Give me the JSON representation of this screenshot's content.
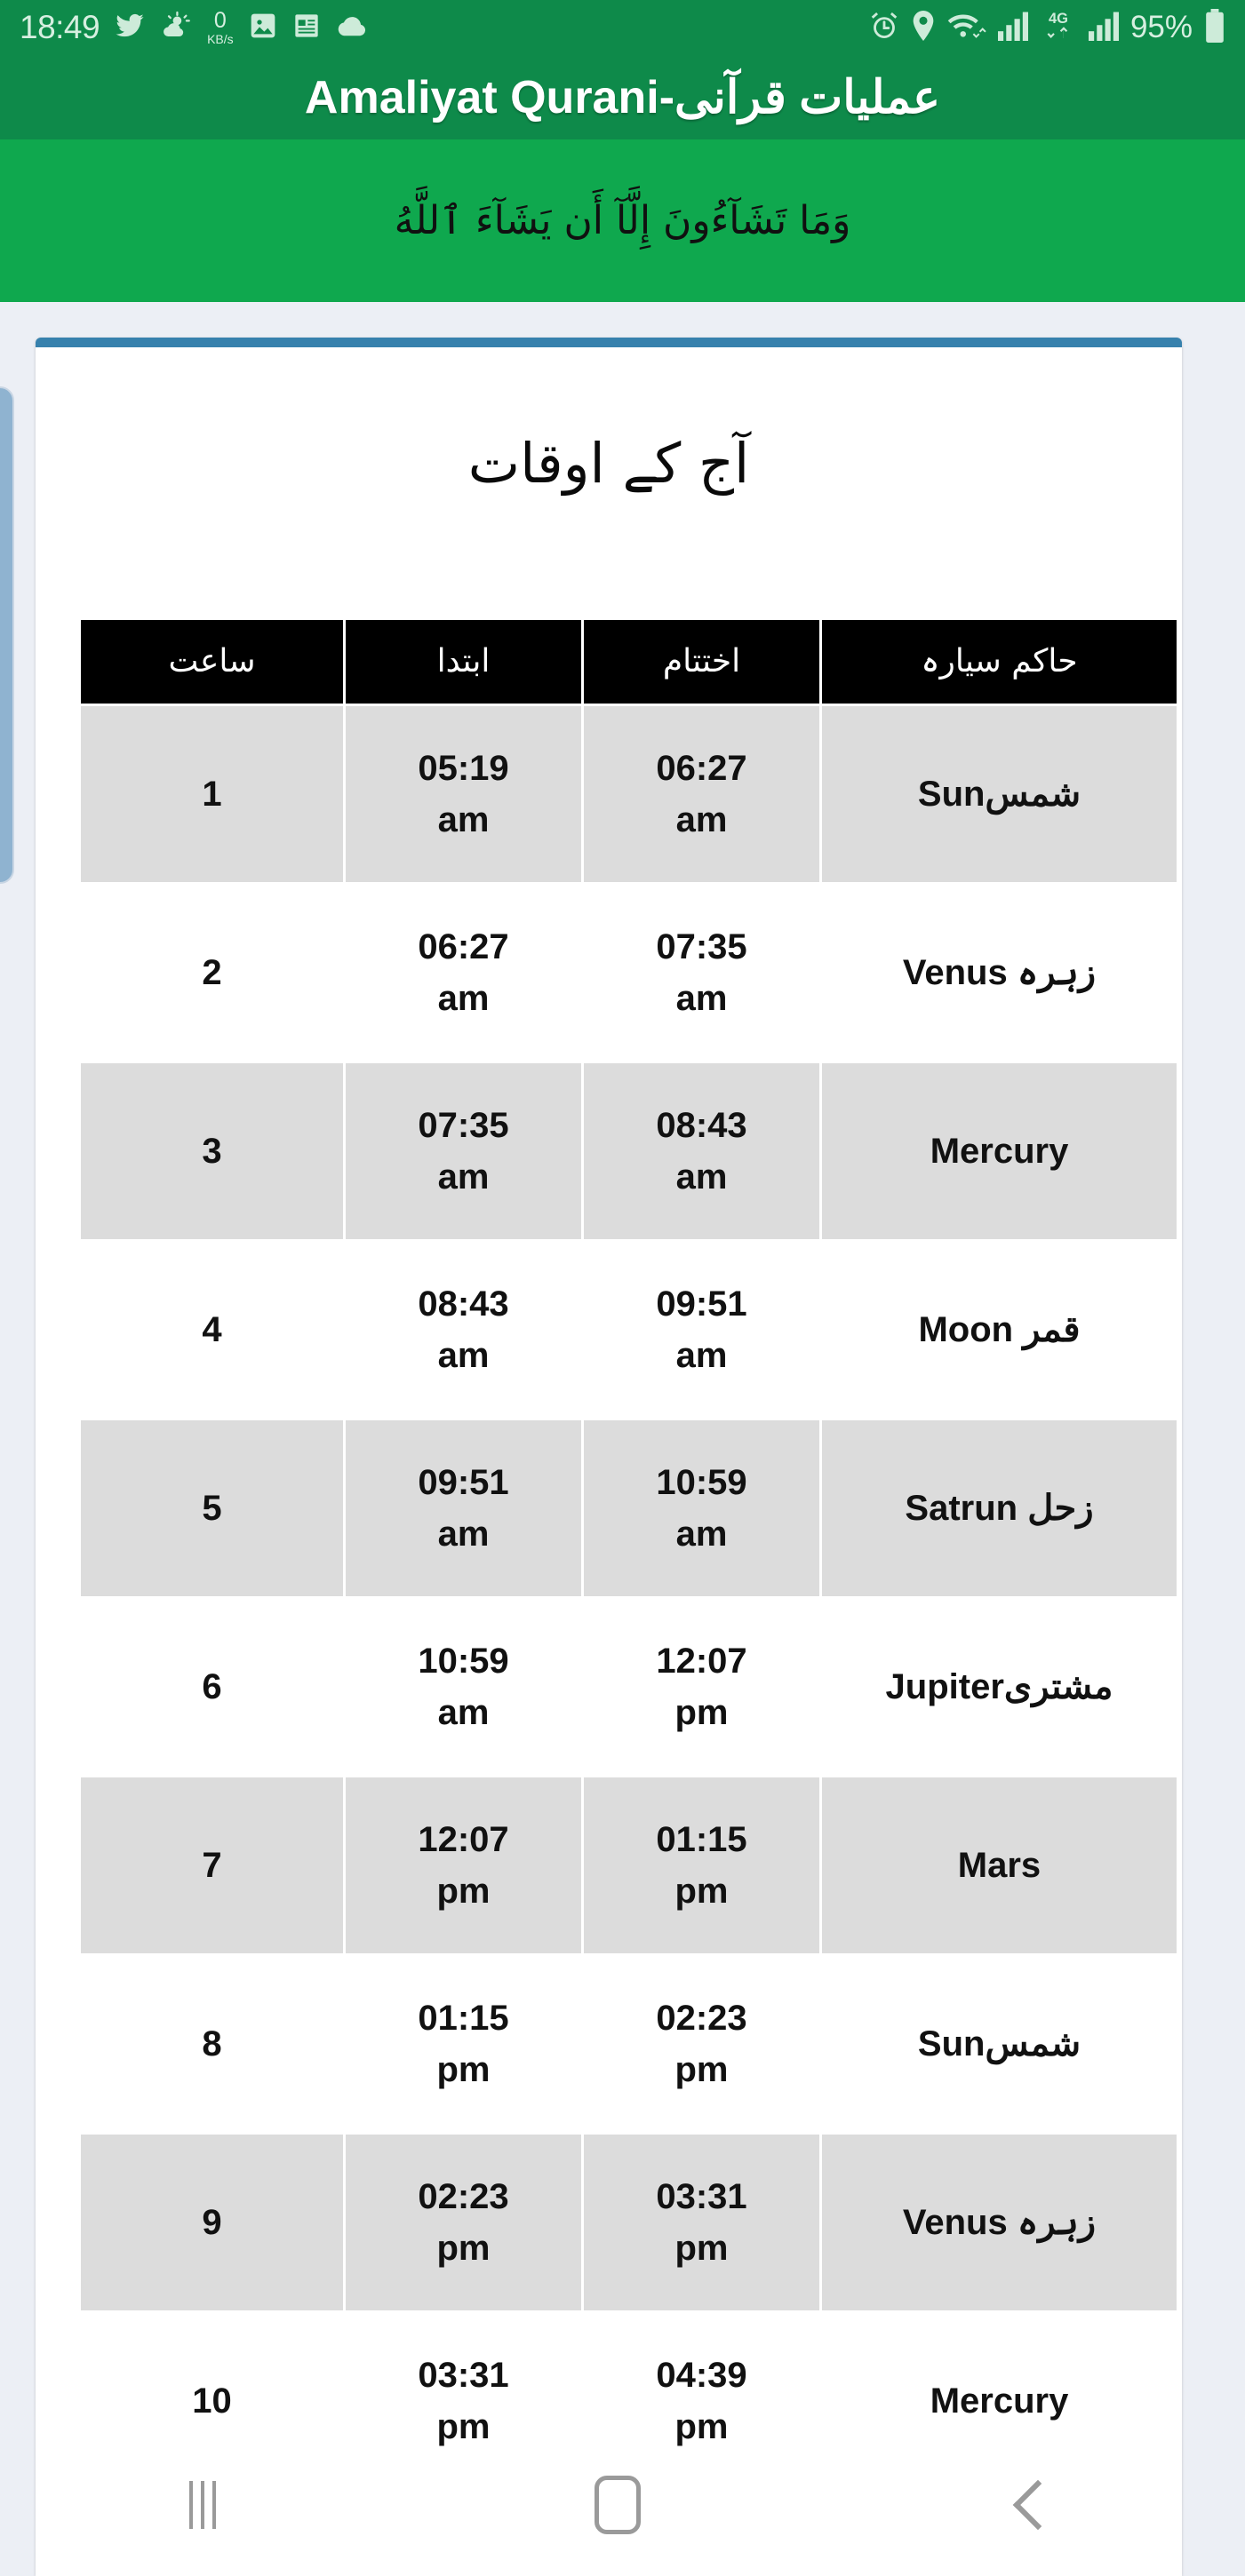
{
  "statusbar": {
    "time": "18:49",
    "data_rate_value": "0",
    "data_rate_unit": "KB/s",
    "battery_percent": "95%",
    "network_type": "4G",
    "icons": [
      "twitter-icon",
      "weather-icon",
      "data-speed-icon",
      "gallery-icon",
      "news-icon",
      "cloud-icon",
      "alarm-icon",
      "location-icon",
      "wifi-icon",
      "signal-icon",
      "mobile-data-icon",
      "signal-icon-2",
      "battery-icon"
    ]
  },
  "appbar": {
    "title": "عملیات قرآنی-Amaliyat Qurani"
  },
  "verse": {
    "text": "وَمَا تَشَآءُونَ إِلَّآ أَن يَشَآءَ ٱللَّهُ"
  },
  "card": {
    "heading": "آج کے اوقات",
    "table": {
      "headers": [
        "ساعت",
        "ابتدا",
        "اختتام",
        "حاکم سیارہ"
      ],
      "rows": [
        {
          "no": "1",
          "start_time": "05:19",
          "start_mer": "am",
          "end_time": "06:27",
          "end_mer": "am",
          "planet": "شمسSun"
        },
        {
          "no": "2",
          "start_time": "06:27",
          "start_mer": "am",
          "end_time": "07:35",
          "end_mer": "am",
          "planet": "زہرہ Venus"
        },
        {
          "no": "3",
          "start_time": "07:35",
          "start_mer": "am",
          "end_time": "08:43",
          "end_mer": "am",
          "planet": "Mercury"
        },
        {
          "no": "4",
          "start_time": "08:43",
          "start_mer": "am",
          "end_time": "09:51",
          "end_mer": "am",
          "planet": "قمر Moon"
        },
        {
          "no": "5",
          "start_time": "09:51",
          "start_mer": "am",
          "end_time": "10:59",
          "end_mer": "am",
          "planet": "زحل Satrun"
        },
        {
          "no": "6",
          "start_time": "10:59",
          "start_mer": "am",
          "end_time": "12:07",
          "end_mer": "pm",
          "planet": "مشتریJupiter"
        },
        {
          "no": "7",
          "start_time": "12:07",
          "start_mer": "pm",
          "end_time": "01:15",
          "end_mer": "pm",
          "planet": "Mars"
        },
        {
          "no": "8",
          "start_time": "01:15",
          "start_mer": "pm",
          "end_time": "02:23",
          "end_mer": "pm",
          "planet": "شمسSun"
        },
        {
          "no": "9",
          "start_time": "02:23",
          "start_mer": "pm",
          "end_time": "03:31",
          "end_mer": "pm",
          "planet": "زہرہ Venus"
        },
        {
          "no": "10",
          "start_time": "03:31",
          "start_mer": "pm",
          "end_time": "04:39",
          "end_mer": "pm",
          "planet": "Mercury"
        }
      ]
    }
  },
  "navbar": {
    "recent_label": "recent-apps",
    "home_label": "home",
    "back_label": "back"
  },
  "colors": {
    "status_green": "#0e8a4a",
    "verse_green": "#0fa84e",
    "card_accent_blue": "#3781ad",
    "row_alt": "#dcdcdc",
    "header_black": "#000000",
    "page_bg": "#eceff5"
  }
}
